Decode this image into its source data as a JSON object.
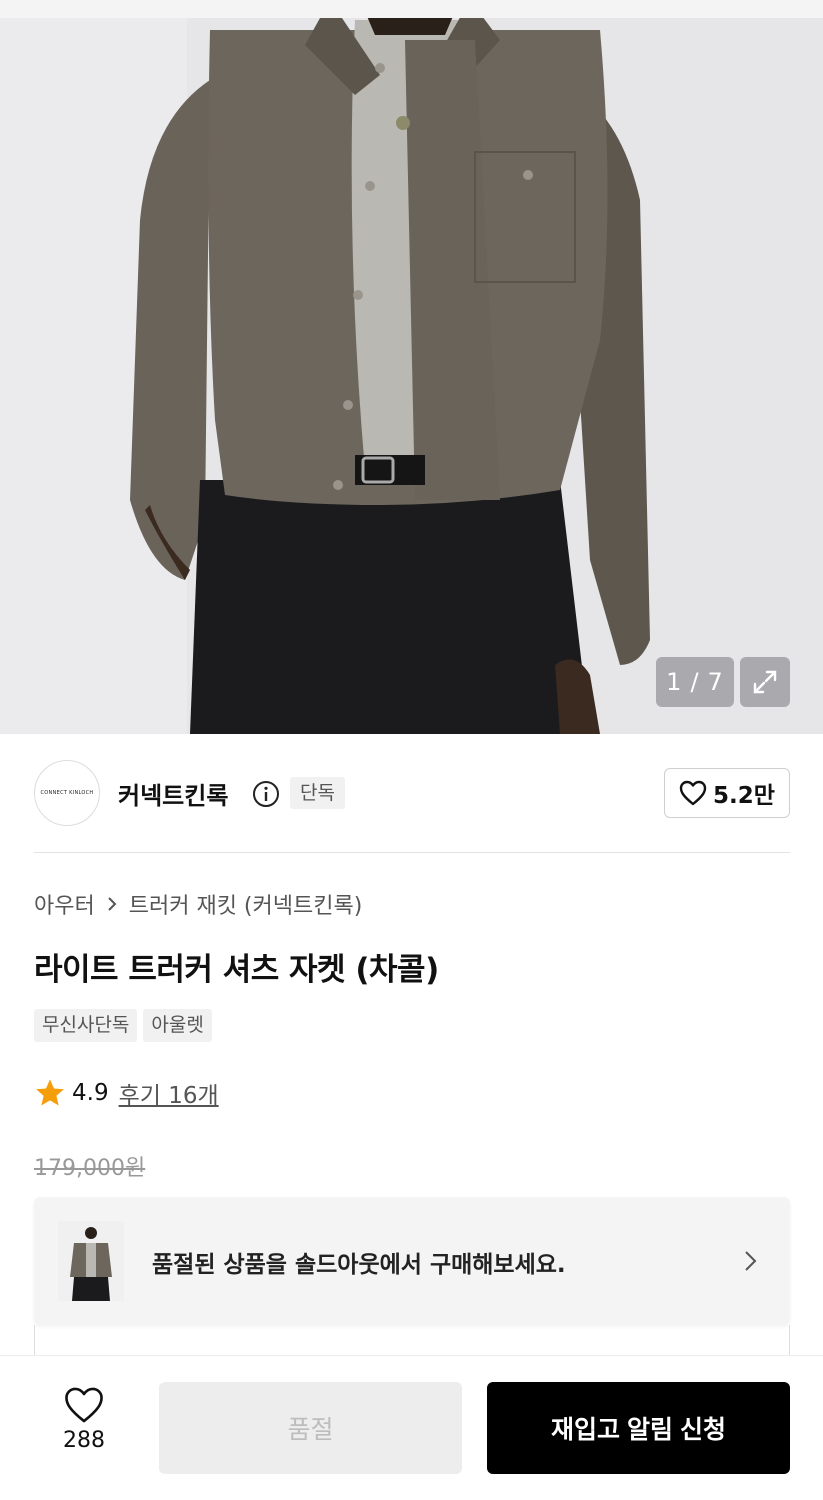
{
  "gallery": {
    "current": "1",
    "separator": "/",
    "total": "7",
    "expand_icon": "expand-arrows-icon"
  },
  "brand": {
    "logo_text": "CONNECT KINLOCH",
    "name": "커넥트킨록",
    "badge": "단독",
    "likes": "5.2만",
    "info_icon": "info-icon",
    "like_icon": "heart-outline-icon"
  },
  "product": {
    "breadcrumb": {
      "category": "아우터",
      "subcategory": "트러커 재킷 (커넥트킨록)"
    },
    "title": "라이트 트러커 셔츠 자켓 (차콜)",
    "tags": [
      "무신사단독",
      "아울렛"
    ],
    "rating": "4.9",
    "reviews": "후기 16개",
    "original_price": "179,000원"
  },
  "banner": {
    "text": "품절된 상품을 솔드아웃에서 구매해보세요.",
    "chevron_icon": "chevron-right-icon"
  },
  "bottom_bar": {
    "wish_count": "288",
    "soldout_label": "품절",
    "restock_label": "재입고 알림 신청"
  },
  "colors": {
    "accent_red": "#e0202a",
    "star": "#f59e0b",
    "primary_button": "#000000"
  }
}
